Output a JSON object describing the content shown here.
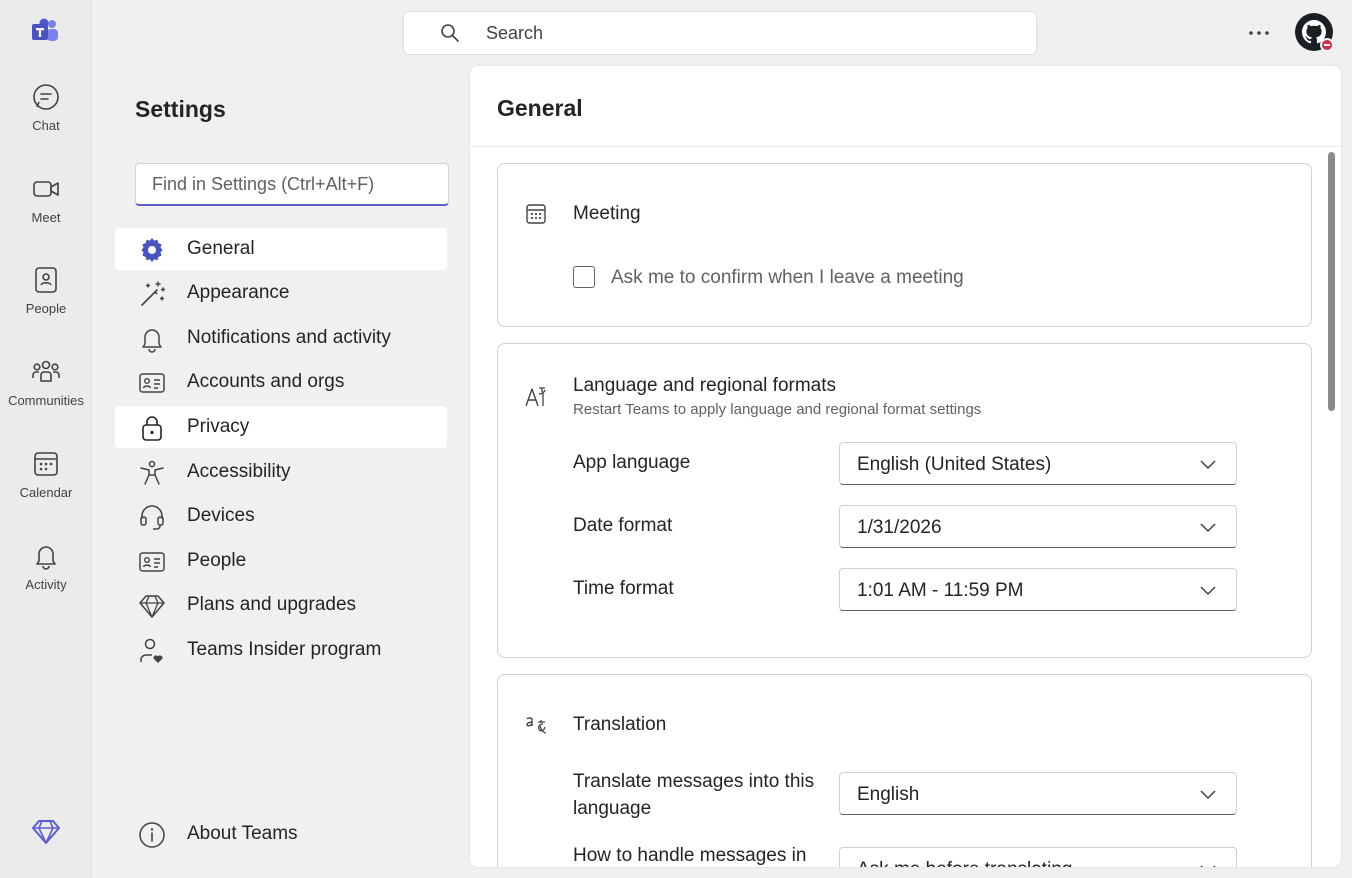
{
  "rail": {
    "items": [
      {
        "label": "Chat"
      },
      {
        "label": "Meet"
      },
      {
        "label": "People"
      },
      {
        "label": "Communities"
      },
      {
        "label": "Calendar"
      },
      {
        "label": "Activity"
      }
    ]
  },
  "topbar": {
    "search_placeholder": "Search"
  },
  "settings": {
    "title": "Settings",
    "find_placeholder": "Find in Settings (Ctrl+Alt+F)",
    "nav": [
      {
        "label": "General",
        "icon": "gear-icon"
      },
      {
        "label": "Appearance",
        "icon": "magic-wand-icon"
      },
      {
        "label": "Notifications and activity",
        "icon": "bell-icon"
      },
      {
        "label": "Accounts and orgs",
        "icon": "id-card-icon"
      },
      {
        "label": "Privacy",
        "icon": "lock-icon"
      },
      {
        "label": "Accessibility",
        "icon": "accessibility-icon"
      },
      {
        "label": "Devices",
        "icon": "headset-icon"
      },
      {
        "label": "People",
        "icon": "contact-card-icon"
      },
      {
        "label": "Plans and upgrades",
        "icon": "diamond-icon"
      },
      {
        "label": "Teams Insider program",
        "icon": "person-heart-icon"
      }
    ],
    "about": "About Teams",
    "selected": "General"
  },
  "general": {
    "title": "General",
    "meeting": {
      "title": "Meeting",
      "confirm_leave_label": "Ask me to confirm when I leave a meeting",
      "confirm_leave_checked": false
    },
    "language": {
      "title": "Language and regional formats",
      "subtitle": "Restart Teams to apply language and regional format settings",
      "app_language_label": "App language",
      "app_language_value": "English (United States)",
      "date_format_label": "Date format",
      "date_format_value": "1/31/2026",
      "time_format_label": "Time format",
      "time_format_value": "1:01 AM - 11:59 PM"
    },
    "translation": {
      "title": "Translation",
      "translate_into_label": "Translate messages into this language",
      "translate_into_value": "English",
      "handle_label": "How to handle messages in",
      "handle_value": "Ask me before translating"
    }
  },
  "colors": {
    "accent": "#5b5fc7",
    "brand": "#4b53bc"
  }
}
